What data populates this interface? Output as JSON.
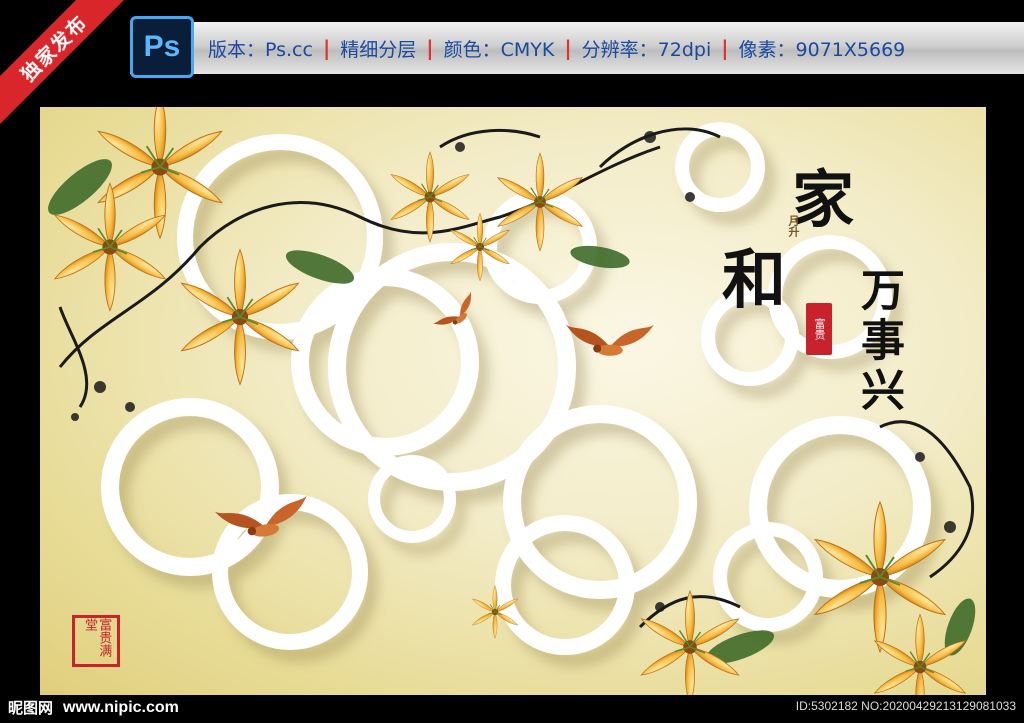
{
  "ribbon": {
    "label": "独家发布"
  },
  "header": {
    "logo_text": "Ps",
    "items": [
      "版本：Ps.cc",
      "精细分层",
      "颜色：CMYK",
      "分辨率：72dpi",
      "像素：9071X5669"
    ],
    "separator": "|"
  },
  "artwork": {
    "calligraphy": {
      "jia": "家",
      "he": "和",
      "wan_shi_xing": "万事兴",
      "small_inscription": "月升",
      "seal_text": "富贵"
    },
    "stamp_text": "富贵满堂",
    "colors": {
      "lily": "#f6b93b",
      "lily_dark": "#c9781a",
      "ring": "#ffffff",
      "bird": "#b5541e",
      "vine": "#1a1a1a",
      "leaf": "#3f6b2a"
    }
  },
  "footer": {
    "site_name": "昵图网",
    "url": "www.nipic.com",
    "id_text": "ID:5302182 NO:20200429213129081033"
  }
}
